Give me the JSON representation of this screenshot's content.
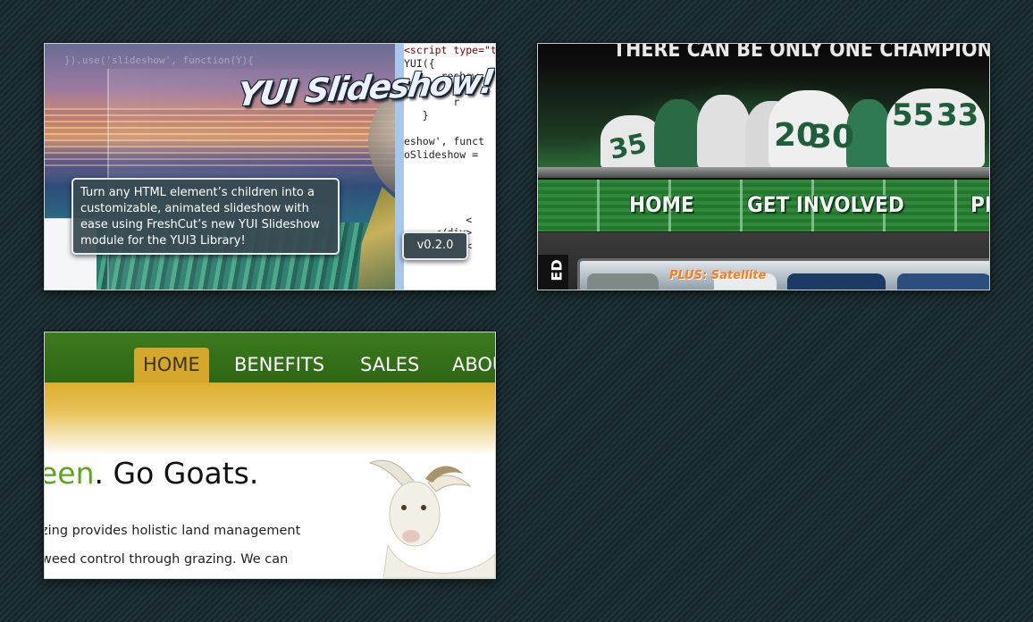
{
  "background": {
    "color": "#1a2c2e"
  },
  "thumbnails": [
    {
      "id": "yui-slideshow",
      "title_graphic": "YUI Slideshow!",
      "description": "Turn any HTML element’s children into a customizable, animated slideshow with ease using FreshCut’s new YUI Slideshow module for the YUI3 Library!",
      "version": "v0.2.0",
      "ghost_code": "}).use('slideshow', function(Y){",
      "code_lines": [
        {
          "cls": "tag",
          "text": "<script type=\"text/javascr"
        },
        {
          "cls": "",
          "text": "YUI({"
        },
        {
          "cls": "",
          "text": "      reshow"
        },
        {
          "cls": "",
          "text": "        f"
        },
        {
          "cls": "",
          "text": "        r"
        },
        {
          "cls": "",
          "text": "   }"
        },
        {
          "cls": "",
          "text": ""
        },
        {
          "cls": "",
          "text": "eshow', funct"
        },
        {
          "cls": "",
          "text": "oSlideshow ="
        },
        {
          "cls": "",
          "text": ""
        },
        {
          "cls": "",
          "text": ""
        },
        {
          "cls": "",
          "text": ""
        },
        {
          "cls": "",
          "text": ""
        },
        {
          "cls": "",
          "text": "          <"
        },
        {
          "cls": "",
          "text": "     </div>"
        },
        {
          "cls": "",
          "text": "          <"
        }
      ]
    },
    {
      "id": "football",
      "slogan": "THERE CAN BE ONLY ONE CHAMPION",
      "jersey_numbers": [
        "35",
        "20",
        "30",
        "55",
        "33"
      ],
      "nav": [
        "HOME",
        "GET INVOLVED",
        "PR"
      ],
      "side_tab": "ED",
      "banner_text": "PLUS: Satellite"
    },
    {
      "id": "goats",
      "nav": [
        "HOME",
        "BENEFITS",
        "SALES",
        "ABOU"
      ],
      "active_nav": "HOME",
      "headline_green": "een",
      "headline_rest": ". Go Goats.",
      "body_lines": [
        "zing provides holistic land management",
        "weed control through grazing. We can"
      ]
    }
  ]
}
